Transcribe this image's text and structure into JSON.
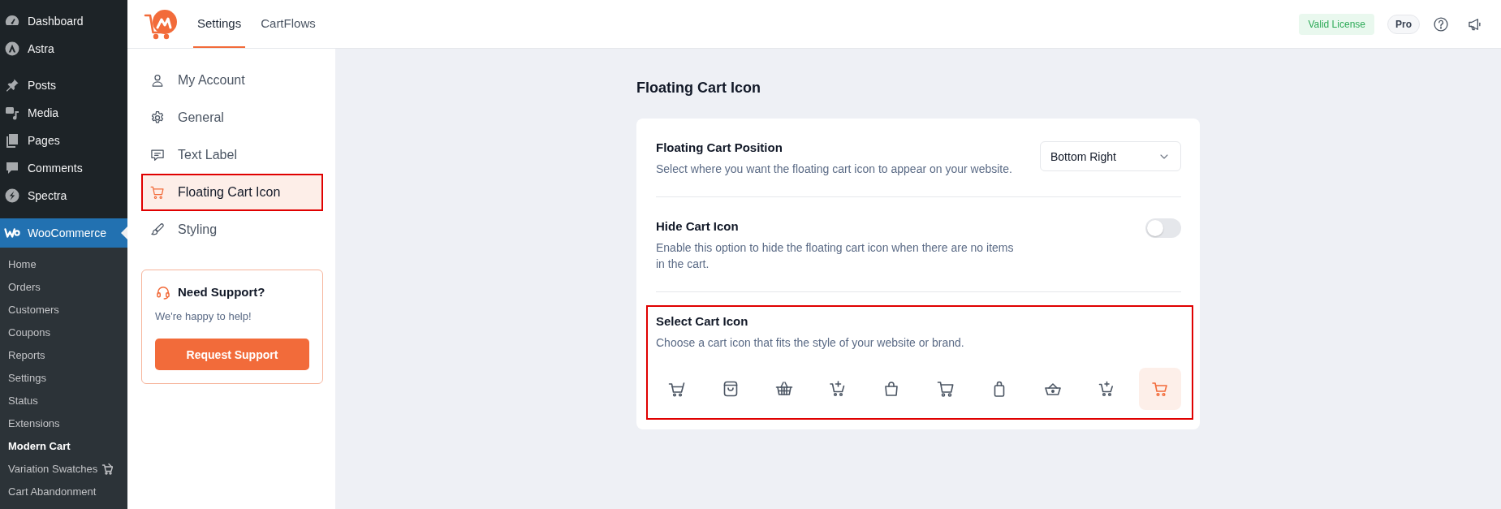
{
  "wp_menu": {
    "groups": [
      {
        "items": [
          {
            "label": "Dashboard",
            "selected": false
          },
          {
            "label": "Astra",
            "selected": false
          }
        ]
      },
      {
        "items": [
          {
            "label": "Posts",
            "selected": false
          },
          {
            "label": "Media",
            "selected": false
          },
          {
            "label": "Pages",
            "selected": false
          },
          {
            "label": "Comments",
            "selected": false
          },
          {
            "label": "Spectra",
            "selected": false
          }
        ]
      },
      {
        "items": [
          {
            "label": "WooCommerce",
            "selected": true,
            "children": [
              {
                "label": "Home",
                "selected": false
              },
              {
                "label": "Orders",
                "selected": false
              },
              {
                "label": "Customers",
                "selected": false
              },
              {
                "label": "Coupons",
                "selected": false
              },
              {
                "label": "Reports",
                "selected": false
              },
              {
                "label": "Settings",
                "selected": false
              },
              {
                "label": "Status",
                "selected": false
              },
              {
                "label": "Extensions",
                "selected": false
              },
              {
                "label": "Modern Cart",
                "selected": true
              },
              {
                "label": "Variation Swatches",
                "selected": false
              },
              {
                "label": "Cart Abandonment",
                "selected": false
              }
            ]
          }
        ]
      }
    ]
  },
  "header": {
    "tabs": [
      {
        "label": "Settings",
        "selected": true
      },
      {
        "label": "CartFlows",
        "selected": false
      }
    ],
    "license_badge": "Valid License",
    "plan_badge": "Pro"
  },
  "settings_nav": {
    "items": [
      {
        "label": "My Account",
        "selected": false,
        "highlighted": false
      },
      {
        "label": "General",
        "selected": false,
        "highlighted": false
      },
      {
        "label": "Text Label",
        "selected": false,
        "highlighted": false
      },
      {
        "label": "Floating Cart Icon",
        "selected": true,
        "highlighted": true
      },
      {
        "label": "Styling",
        "selected": false,
        "highlighted": false
      }
    ]
  },
  "support_card": {
    "title": "Need Support?",
    "text": "We're happy to help!",
    "button": "Request Support"
  },
  "page": {
    "title": "Floating Cart Icon",
    "settings": [
      {
        "kind": "select",
        "title": "Floating Cart Position",
        "description": "Select where you want the floating cart icon to appear on your website.",
        "value": "Bottom Right",
        "highlighted": false
      },
      {
        "kind": "toggle",
        "title": "Hide Cart Icon",
        "description": "Enable this option to hide the floating cart icon when there are no items in the cart.",
        "on": false,
        "highlighted": false
      },
      {
        "kind": "icon_picker",
        "title": "Select Cart Icon",
        "description": "Choose a cart icon that fits the style of your website or brand.",
        "highlighted": true,
        "options": [
          {
            "selected": false
          },
          {
            "selected": false
          },
          {
            "selected": false
          },
          {
            "selected": false
          },
          {
            "selected": false
          },
          {
            "selected": false
          },
          {
            "selected": false
          },
          {
            "selected": false
          },
          {
            "selected": false
          },
          {
            "selected": true
          }
        ]
      }
    ]
  }
}
